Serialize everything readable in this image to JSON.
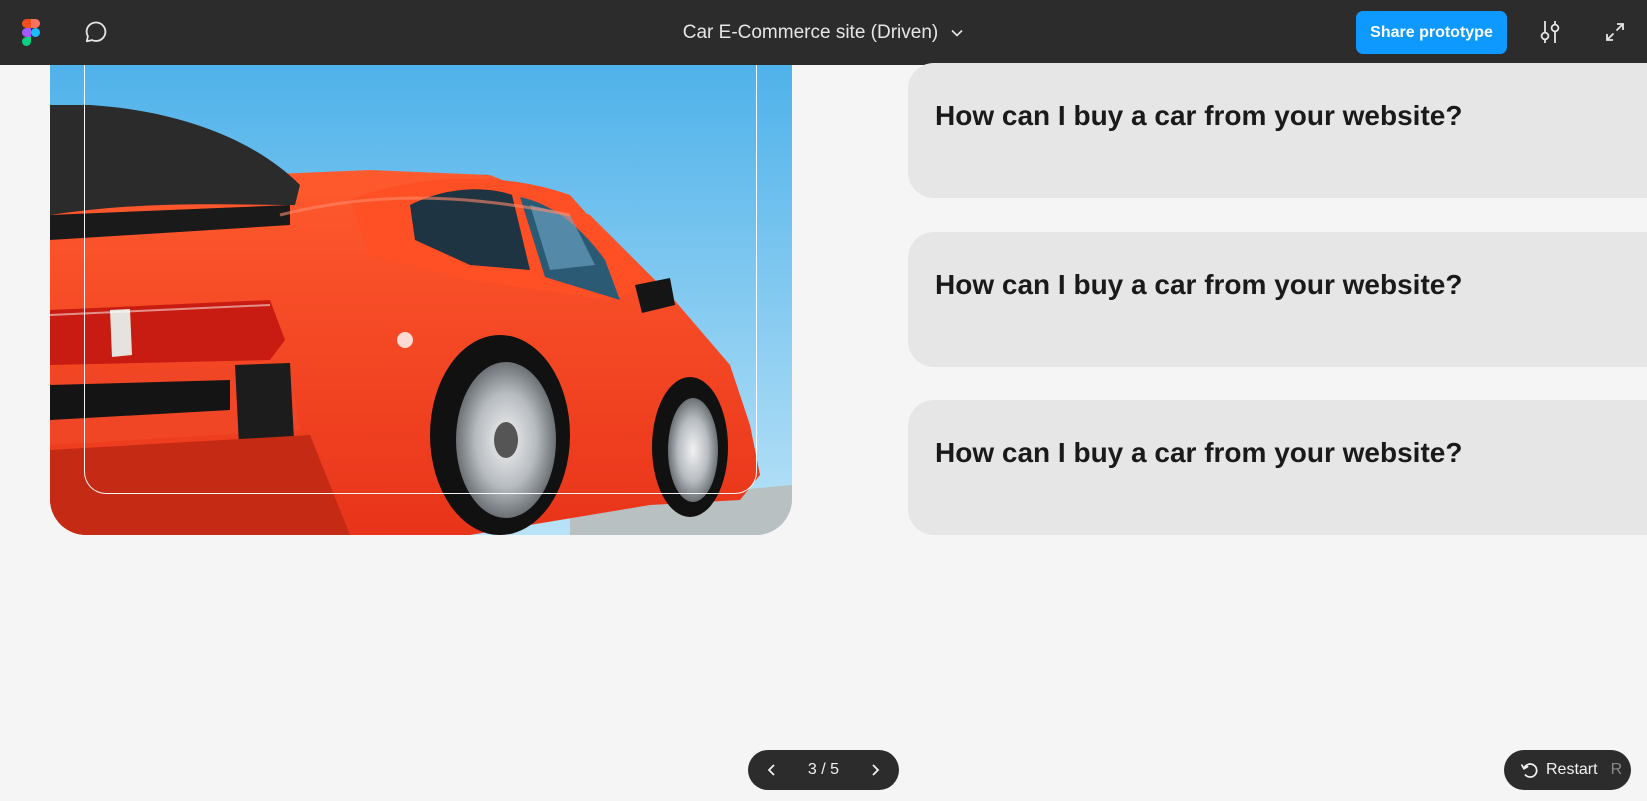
{
  "toolbar": {
    "title": "Car E-Commerce site (Driven)",
    "share_label": "Share prototype"
  },
  "hero": {
    "image": "red sports car rear three-quarter view against blue sky"
  },
  "faq": [
    {
      "question": "How can I buy a car from your website?"
    },
    {
      "question": "How can I buy a car from your website?"
    },
    {
      "question": "How can I buy a car from your website?"
    }
  ],
  "pager": {
    "counter": "3 / 5"
  },
  "restart": {
    "label": "Restart",
    "shortcut": "R"
  },
  "colors": {
    "topbar": "#2c2c2c",
    "accent": "#0d99ff",
    "canvas": "#f5f5f5",
    "card": "#e6e6e6",
    "car_body": "#ff4a22",
    "sky": "#5cb8ec"
  }
}
